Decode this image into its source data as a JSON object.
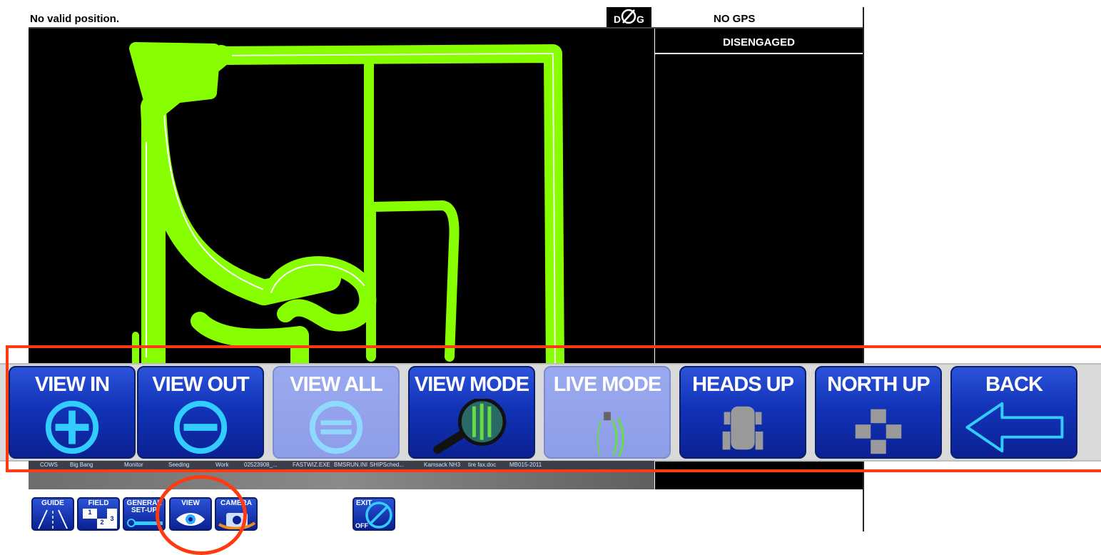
{
  "header": {
    "status": "No valid position.",
    "dgps_badge": "D G",
    "gps_status": "NO GPS"
  },
  "side_panel": {
    "engage_state": "DISENGAGED"
  },
  "toolbar": {
    "buttons": [
      {
        "label": "VIEW IN",
        "icon": "zoom-in-icon",
        "enabled": true
      },
      {
        "label": "VIEW OUT",
        "icon": "zoom-out-icon",
        "enabled": true
      },
      {
        "label": "VIEW ALL",
        "icon": "view-all-icon",
        "enabled": false
      },
      {
        "label": "VIEW MODE",
        "icon": "magnifier-icon",
        "enabled": true
      },
      {
        "label": "LIVE MODE",
        "icon": "live-mode-icon",
        "enabled": false
      },
      {
        "label": "HEADS UP",
        "icon": "vehicle-icon",
        "enabled": true
      },
      {
        "label": "NORTH UP",
        "icon": "cross-icon",
        "enabled": true
      },
      {
        "label": "BACK",
        "icon": "back-arrow-icon",
        "enabled": true
      }
    ]
  },
  "taskbar": {
    "items": [
      "COWS",
      "Big Bang",
      "Monitor",
      "Seeding",
      "Work",
      "02523908_...",
      "FASTWIZ.EXE",
      "BMSRUN.INI",
      "SHIPSched...",
      "Kamsack NH3",
      "tire fax.doc",
      "MB015-2011"
    ]
  },
  "bottom_nav": {
    "buttons": [
      {
        "label": "GUIDE",
        "icon": "guide-lines-icon"
      },
      {
        "label": "FIELD",
        "icon": "field-icon",
        "digits": [
          "1",
          "2",
          "3"
        ]
      },
      {
        "label": "GENERAL SET-UP",
        "icon": "wrench-icon"
      },
      {
        "label": "VIEW",
        "icon": "eye-icon"
      },
      {
        "label": "CAMERA",
        "icon": "camera-icon"
      },
      {
        "label": "EXIT",
        "sublabel": "OFF",
        "icon": "no-entry-icon"
      }
    ]
  },
  "colors": {
    "coverage": "#88ff00",
    "button_blue": "#1233b8",
    "highlight": "#ff3a10"
  }
}
